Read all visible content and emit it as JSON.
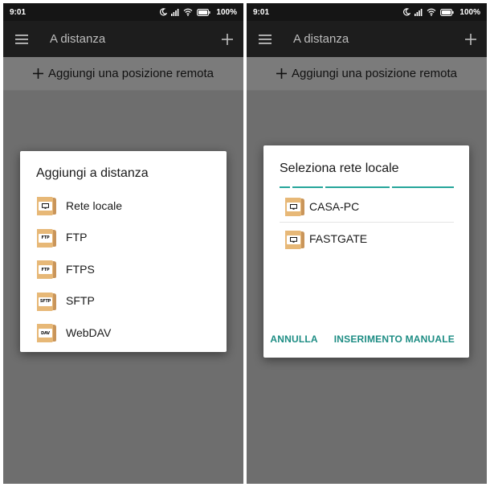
{
  "colors": {
    "statusbar_bg": "#151515",
    "appbar_bg": "#1d1d1d",
    "scrim": "#6e6e6e",
    "accent": "#26a69a",
    "folder": "#e7b877"
  },
  "screens": [
    {
      "status": {
        "time": "9:01",
        "battery": "100%"
      },
      "appbar": {
        "title": "A distanza",
        "menu_icon": "hamburger-menu-icon",
        "action_icon": "plus-icon"
      },
      "add_remote": {
        "label": "Aggiungi una posizione remota"
      },
      "dialog": {
        "title": "Aggiungi a distanza",
        "options": [
          {
            "label": "Rete locale",
            "icon": "monitor-icon"
          },
          {
            "label": "FTP",
            "tag": "FTP"
          },
          {
            "label": "FTPS",
            "tag": "FTP"
          },
          {
            "label": "SFTP",
            "tag": "SFTP"
          },
          {
            "label": "WebDAV",
            "tag": "DAV"
          }
        ]
      }
    },
    {
      "status": {
        "time": "9:01",
        "battery": "100%"
      },
      "appbar": {
        "title": "A distanza",
        "menu_icon": "hamburger-menu-icon",
        "action_icon": "plus-icon"
      },
      "add_remote": {
        "label": "Aggiungi una posizione remota"
      },
      "dialog": {
        "title": "Seleziona rete locale",
        "networks": [
          {
            "label": "CASA-PC"
          },
          {
            "label": "FASTGATE"
          }
        ],
        "cancel_label": "ANNULLA",
        "manual_label": "INSERIMENTO MANUALE"
      }
    }
  ]
}
